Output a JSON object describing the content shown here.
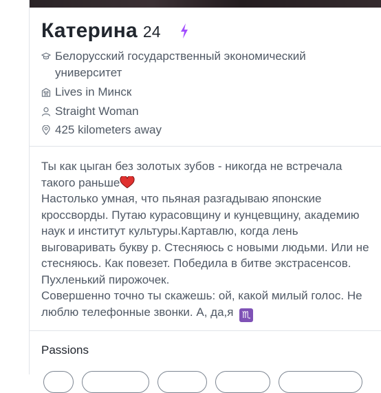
{
  "profile": {
    "name": "Катерина",
    "age": "24",
    "verified_icon": "bolt-icon",
    "info": {
      "school": "Белорусский государственный экономический университет",
      "location": "Lives in Минск",
      "orientation": "Straight Woman",
      "distance": "425 kilometers away"
    },
    "bio": {
      "line1": "Ты как цыган без золотых зубов - никогда не встречала такого раньше",
      "heart_emoji": "❣️",
      "line2": "Настолько умная, что пьяная разгадываю японские кроссворды. Путаю курасовщину и кунцевщину, академию наук и институт культуры.Картавлю, когда лень выговаривать букву р. Стесняюсь с новыми людьми. Или не стесняюсь. Как повезет. Победила в битве экстрасенсов. Пухленький пирожочек.",
      "line3": "Совершенно точно ты скажешь: ой, какой милый голос. Не люблю телефонные звонки. А, да,я",
      "zodiac_emoji": "♏"
    }
  },
  "passions": {
    "title": "Passions"
  },
  "colors": {
    "accent_bolt": "#a24dff",
    "text_dark": "#21262e",
    "text_secondary": "#505965",
    "divider": "#e0e3e8"
  }
}
